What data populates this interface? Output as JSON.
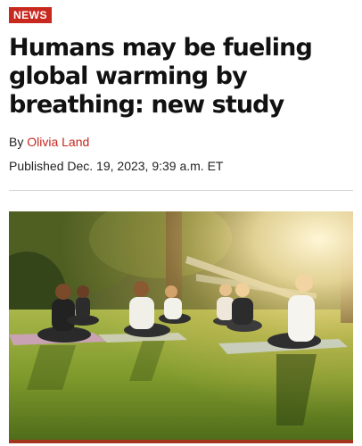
{
  "badge": {
    "label": "NEWS"
  },
  "article": {
    "headline": "Humans may be fueling global warming by breathing: new study",
    "byline_prefix": "By",
    "author": "Olivia Land",
    "published": "Published Dec. 19, 2023, 9:39 a.m. ET"
  },
  "colors": {
    "accent": "#c8281e",
    "text": "#111111",
    "divider": "#d4d4d4"
  },
  "image": {
    "subject": "people meditating cross-legged on grass in a sunlit park"
  }
}
